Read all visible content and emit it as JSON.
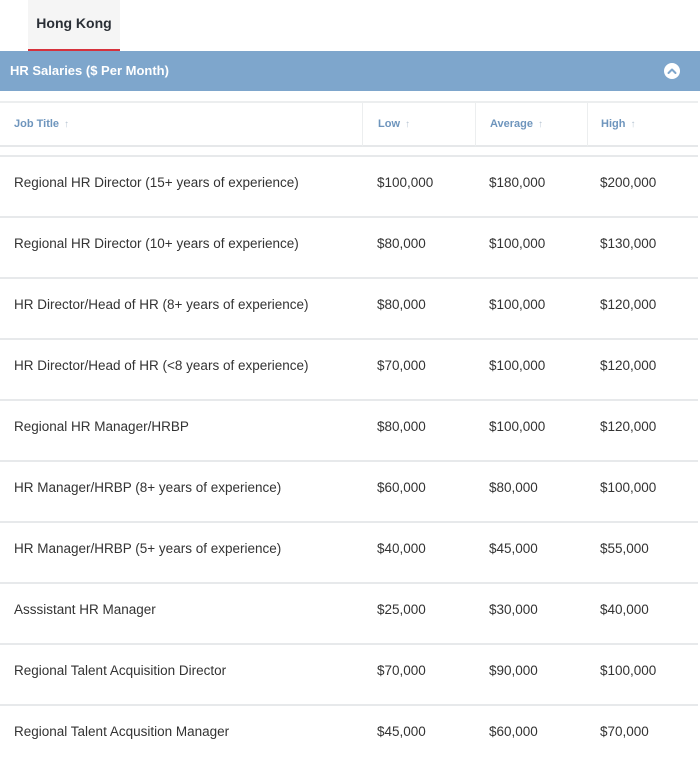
{
  "tab": {
    "label": "Hong Kong"
  },
  "section": {
    "title": "HR Salaries ($ Per Month)"
  },
  "icons": {
    "collapse": "chevron-up-icon",
    "sort": "sort-arrow-icon"
  },
  "colors": {
    "accent": "#7ea6cc",
    "tab_underline": "#d6323c",
    "header_text": "#6e95bd"
  },
  "table": {
    "headers": [
      "Job Title",
      "Low",
      "Average",
      "High"
    ],
    "sort_glyph": "↑",
    "rows": [
      [
        "Regional HR Director (15+ years of experience)",
        "$100,000",
        "$180,000",
        "$200,000"
      ],
      [
        "Regional HR Director (10+ years of experience)",
        "$80,000",
        "$100,000",
        "$130,000"
      ],
      [
        "HR Director/Head of HR (8+ years of experience)",
        "$80,000",
        "$100,000",
        "$120,000"
      ],
      [
        "HR Director/Head of HR (<8 years of experience)",
        "$70,000",
        "$100,000",
        "$120,000"
      ],
      [
        "Regional HR Manager/HRBP",
        "$80,000",
        "$100,000",
        "$120,000"
      ],
      [
        "HR Manager/HRBP (8+ years of experience)",
        "$60,000",
        "$80,000",
        "$100,000"
      ],
      [
        "HR Manager/HRBP (5+ years of experience)",
        "$40,000",
        "$45,000",
        "$55,000"
      ],
      [
        "Asssistant HR Manager",
        "$25,000",
        "$30,000",
        "$40,000"
      ],
      [
        "Regional Talent Acquisition Director",
        "$70,000",
        "$90,000",
        "$100,000"
      ],
      [
        "Regional Talent Acqusition Manager",
        "$45,000",
        "$60,000",
        "$70,000"
      ]
    ]
  }
}
